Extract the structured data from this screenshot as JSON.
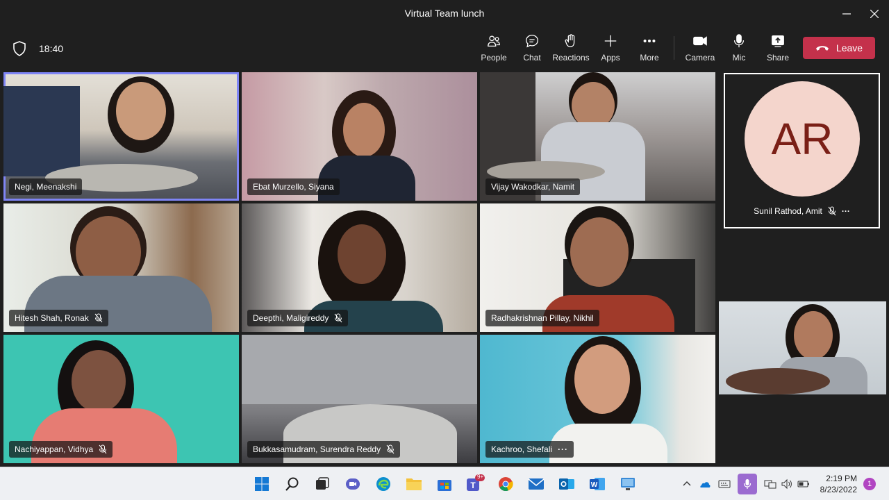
{
  "window": {
    "title": "Virtual Team lunch"
  },
  "toolbar": {
    "timer": "18:40",
    "buttons": {
      "people": "People",
      "chat": "Chat",
      "reactions": "Reactions",
      "apps": "Apps",
      "more": "More",
      "camera": "Camera",
      "mic": "Mic",
      "share": "Share"
    },
    "leave": "Leave"
  },
  "participants": [
    {
      "name": "Negi, Meenakshi",
      "muted": false
    },
    {
      "name": "Ebat Murzello, Siyana",
      "muted": false
    },
    {
      "name": "Vijay Wakodkar, Namit",
      "muted": false
    },
    {
      "name": "Hitesh Shah, Ronak",
      "muted": true
    },
    {
      "name": "Deepthi, Maligireddy",
      "muted": true
    },
    {
      "name": "Radhakrishnan Pillay, Nikhil",
      "muted": false
    },
    {
      "name": "Nachiyappan, Vidhya",
      "muted": true
    },
    {
      "name": "Bukkasamudram, Surendra Reddy",
      "muted": true
    },
    {
      "name": "Kachroo, Shefali",
      "muted": false,
      "more": "···"
    }
  ],
  "side": {
    "avatar_initials": "AR",
    "avatar_name": "Sunil Rathod, Amit",
    "avatar_more": "···"
  },
  "taskbar": {
    "time": "2:19 PM",
    "date": "8/23/2022",
    "teams_badge": "9+",
    "notifications": "1"
  },
  "colors": {
    "leave": "#c4314b",
    "active_speaker": "#7f85f5",
    "avatar_bg": "#f4d5cc",
    "avatar_text": "#7a1f16"
  }
}
